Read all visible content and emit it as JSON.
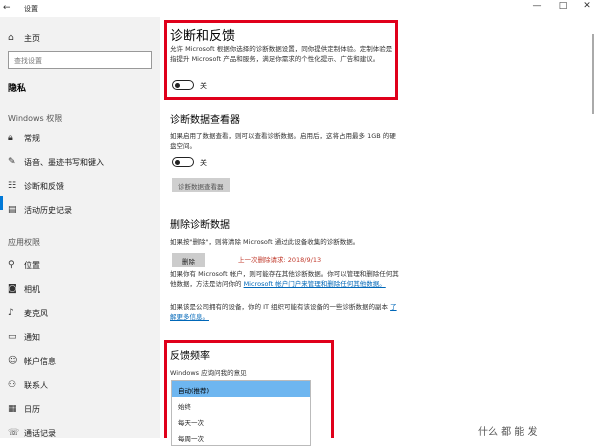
{
  "window": {
    "title": "设置",
    "controls": [
      "—",
      "□",
      "✕"
    ]
  },
  "sidebar": {
    "home_label": "主页",
    "search_placeholder": "查找设置",
    "section_title": "隐私",
    "group_windows": "Windows 权限",
    "items_windows": [
      {
        "label": "常规",
        "icon": "lock-icon"
      },
      {
        "label": "语音、墨迹书写和键入",
        "icon": "pen-icon"
      },
      {
        "label": "诊断和反馈",
        "icon": "feedback-icon",
        "selected": true
      },
      {
        "label": "活动历史记录",
        "icon": "history-icon"
      }
    ],
    "group_app": "应用权限",
    "items_app": [
      {
        "label": "位置",
        "icon": "location-icon"
      },
      {
        "label": "相机",
        "icon": "camera-icon"
      },
      {
        "label": "麦克风",
        "icon": "microphone-icon"
      },
      {
        "label": "通知",
        "icon": "notification-icon"
      },
      {
        "label": "帐户信息",
        "icon": "account-icon"
      },
      {
        "label": "联系人",
        "icon": "contacts-icon"
      },
      {
        "label": "日历",
        "icon": "calendar-icon"
      },
      {
        "label": "通话记录",
        "icon": "call-history-icon"
      }
    ]
  },
  "main": {
    "section1": {
      "title": "诊断和反馈",
      "desc": "允许 Microsoft 根据你选择的诊断数据设置，同你提供定制体验。定制体验是指提升 Microsoft 产品和服务，满足你需求的个性化提示、广告和建议。",
      "toggle_label": "关"
    },
    "section2": {
      "title": "诊断数据查看器",
      "desc": "如果启用了数据查看，则可以查看诊断数据。启用后，这将占用最多 1GB 的硬盘空间。",
      "toggle_label": "关",
      "button": "诊断数据查看器"
    },
    "section3": {
      "title": "删除诊断数据",
      "desc": "如果按\"删除\"，则将清除 Microsoft 通过此设备收集的诊断数据。",
      "button": "删除",
      "last_delete": "上一次删除请求: 2018/9/13",
      "para1_a": "如果你有 Microsoft 帐户，则可能存在其他诊断数据。你可以管理和删除任何其他数据，方法是访问你的 ",
      "para1_link": "Microsoft 帐户门户来管理和删除任何其他数据。",
      "para2_a": "如果该是公司拥有的设备，你的 IT 组织可能有该设备的一些诊断数据的副本 ",
      "para2_link": "了解更多信息。"
    },
    "section4": {
      "title": "反馈频率",
      "label": "Windows 应询问我的意见",
      "options": [
        "自动(推荐)",
        "始终",
        "每天一次",
        "每周一次"
      ],
      "selected_index": 0
    }
  },
  "watermark": "什么 都 能 发"
}
